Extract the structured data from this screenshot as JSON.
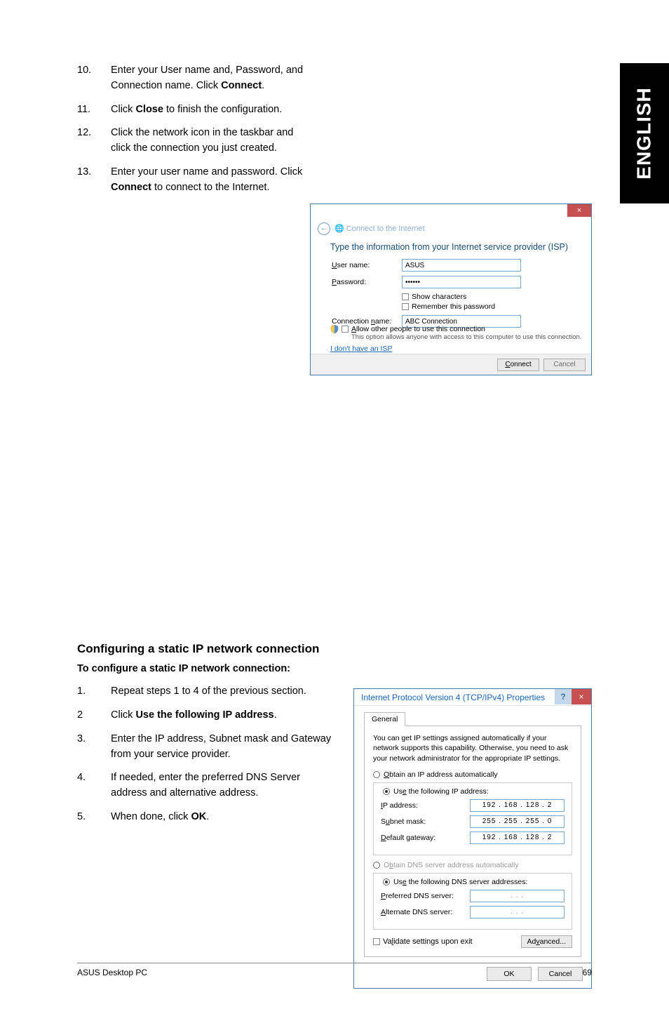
{
  "tab": {
    "label": "ENGLISH"
  },
  "steps_top": [
    {
      "n": "10.",
      "t1": "Enter your User name and, Password, and Connection name. Click ",
      "b": "Connect",
      "t2": "."
    },
    {
      "n": "11.",
      "t1": "Click ",
      "b": "Close",
      "t2": " to finish the configuration."
    },
    {
      "n": "12.",
      "t1": "Click the network icon in the taskbar and click the connection you just created."
    },
    {
      "n": "13.",
      "t1": "Enter your user name and password. Click ",
      "b": "Connect",
      "t2": " to connect to the Internet."
    }
  ],
  "dialog1": {
    "breadcrumb_icon": "←",
    "breadcrumb": "Connect to the Internet",
    "heading": "Type the information from your Internet service provider (ISP)",
    "user_label": "User name:",
    "user_value": "ASUS",
    "pass_label": "Password:",
    "pass_value": "••••••",
    "show_chars": "Show characters",
    "remember": "Remember this password",
    "conn_label": "Connection name:",
    "conn_value": "ABC Connection",
    "allow": "Allow other people to use this connection",
    "allow_sub": "This option allows anyone with access to this computer to use this connection.",
    "noisp": "I don't have an ISP",
    "btn_connect": "Connect",
    "btn_cancel": "Cancel",
    "close_x": "×"
  },
  "section2": {
    "heading": "Configuring a static IP network connection",
    "subheading": "To configure a static IP network connection:"
  },
  "steps_bottom": [
    {
      "n": "1.",
      "t": "Repeat steps 1 to 4 of the previous section."
    },
    {
      "n": "2",
      "t1": "Click ",
      "b": "Use the following IP address",
      "t2": "."
    },
    {
      "n": "3.",
      "t": "Enter the IP address, Subnet mask and Gateway from your service provider."
    },
    {
      "n": "4.",
      "t": "If needed, enter the preferred DNS Server address and alternative address."
    },
    {
      "n": "5.",
      "t1": "When done, click ",
      "b": "OK",
      "t2": "."
    }
  ],
  "dialog2": {
    "title": "Internet Protocol Version 4 (TCP/IPv4) Properties",
    "help": "?",
    "x": "×",
    "tab": "General",
    "desc": "You can get IP settings assigned automatically if your network supports this capability. Otherwise, you need to ask your network administrator for the appropriate IP settings.",
    "r_obtain_ip": "Obtain an IP address automatically",
    "r_use_ip": "Use the following IP address:",
    "f_ip": "IP address:",
    "v_ip": "192 . 168 . 128 .   2",
    "f_mask": "Subnet mask:",
    "v_mask": "255 . 255 . 255 .   0",
    "f_gw": "Default gateway:",
    "v_gw": "192 . 168 . 128 .   2",
    "r_obtain_dns": "Obtain DNS server address automatically",
    "r_use_dns": "Use the following DNS server addresses:",
    "f_pdns": "Preferred DNS server:",
    "v_pdns": ".       .       .",
    "f_adns": "Alternate DNS server:",
    "v_adns": ".       .       .",
    "validate": "Validate settings upon exit",
    "advanced": "Advanced...",
    "ok": "OK",
    "cancel": "Cancel"
  },
  "footer": {
    "left": "ASUS Desktop PC",
    "right": "69"
  }
}
